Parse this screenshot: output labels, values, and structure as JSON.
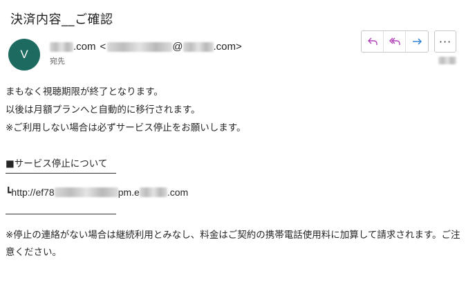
{
  "email": {
    "subject": "決済内容__ご確認",
    "avatar_letter": "V",
    "sender_domain_suffix": ".com",
    "sender_open": "<",
    "sender_at": "@",
    "sender_close": ".com>",
    "recipient_label": "宛先"
  },
  "actions": {
    "reply_icon": "reply-icon",
    "reply_all_icon": "reply-all-icon",
    "forward_icon": "forward-icon",
    "more_label": "···",
    "accent_color": "#b03db8",
    "forward_color": "#2b7cd3"
  },
  "body": {
    "line1": "まもなく視聴期限が終了となります。",
    "line2": "以後は月額プランへと自動的に移行されます。",
    "line3": "※ご利用しない場合は必ずサービス停止をお願いします。",
    "section_heading": "■サービス停止について",
    "url_prefix": "┗http://ef78",
    "url_mid": "pm.e",
    "url_suffix": ".com",
    "notice": "※停止の連絡がない場合は継続利用とみなし、料金はご契約の携帯電話使用料に加算して請求されます。ご注意ください。"
  }
}
